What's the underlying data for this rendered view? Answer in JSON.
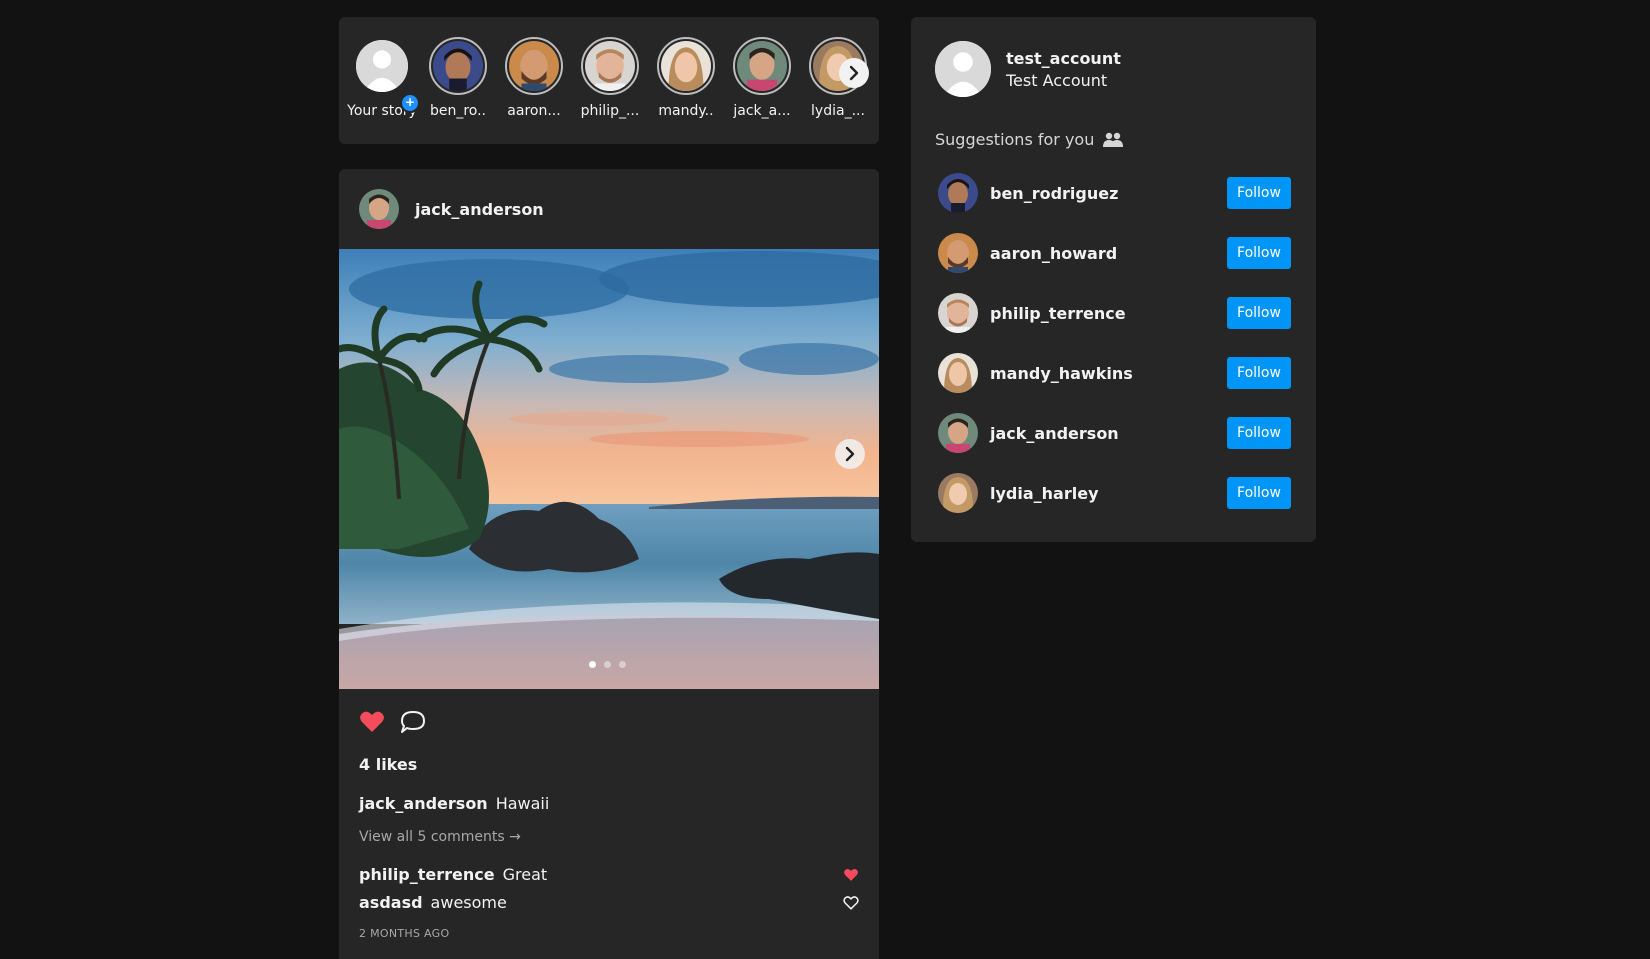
{
  "stories": {
    "your_story_label": "Your story",
    "items": [
      {
        "label": "ben_ro..",
        "avatar": "ben"
      },
      {
        "label": "aaron...",
        "avatar": "aaron"
      },
      {
        "label": "philip_...",
        "avatar": "philip"
      },
      {
        "label": "mandy..",
        "avatar": "mandy"
      },
      {
        "label": "jack_a...",
        "avatar": "jack"
      },
      {
        "label": "lydia_...",
        "avatar": "lydia"
      }
    ],
    "next_icon": "chevron-right-icon"
  },
  "post": {
    "username": "jack_anderson",
    "image": "beach-sunset-palm-trees",
    "slides": 3,
    "active_slide": 1,
    "next_icon": "chevron-right-icon",
    "liked": true,
    "likes_text": "4 likes",
    "caption_user": "jack_anderson",
    "caption_text": "Hawaii",
    "view_comments": "View all 5 comments →",
    "comments": [
      {
        "user": "philip_terrence",
        "text": "Great",
        "liked": true
      },
      {
        "user": "asdasd",
        "text": "awesome",
        "liked": false
      }
    ],
    "time_ago": "2 MONTHS AGO"
  },
  "sidebar": {
    "username": "test_account",
    "full_name": "Test Account",
    "suggestions_title": "Suggestions for you",
    "suggestions_icon": "users-icon",
    "suggestions": [
      {
        "username": "ben_rodriguez",
        "button": "Follow"
      },
      {
        "username": "aaron_howard",
        "button": "Follow"
      },
      {
        "username": "philip_terrence",
        "button": "Follow"
      },
      {
        "username": "mandy_hawkins",
        "button": "Follow"
      },
      {
        "username": "jack_anderson",
        "button": "Follow"
      },
      {
        "username": "lydia_harley",
        "button": "Follow"
      }
    ]
  },
  "colors": {
    "background": "#121212",
    "card": "#262626",
    "accent_blue": "#0095f6",
    "like_red": "#f44c5b"
  }
}
